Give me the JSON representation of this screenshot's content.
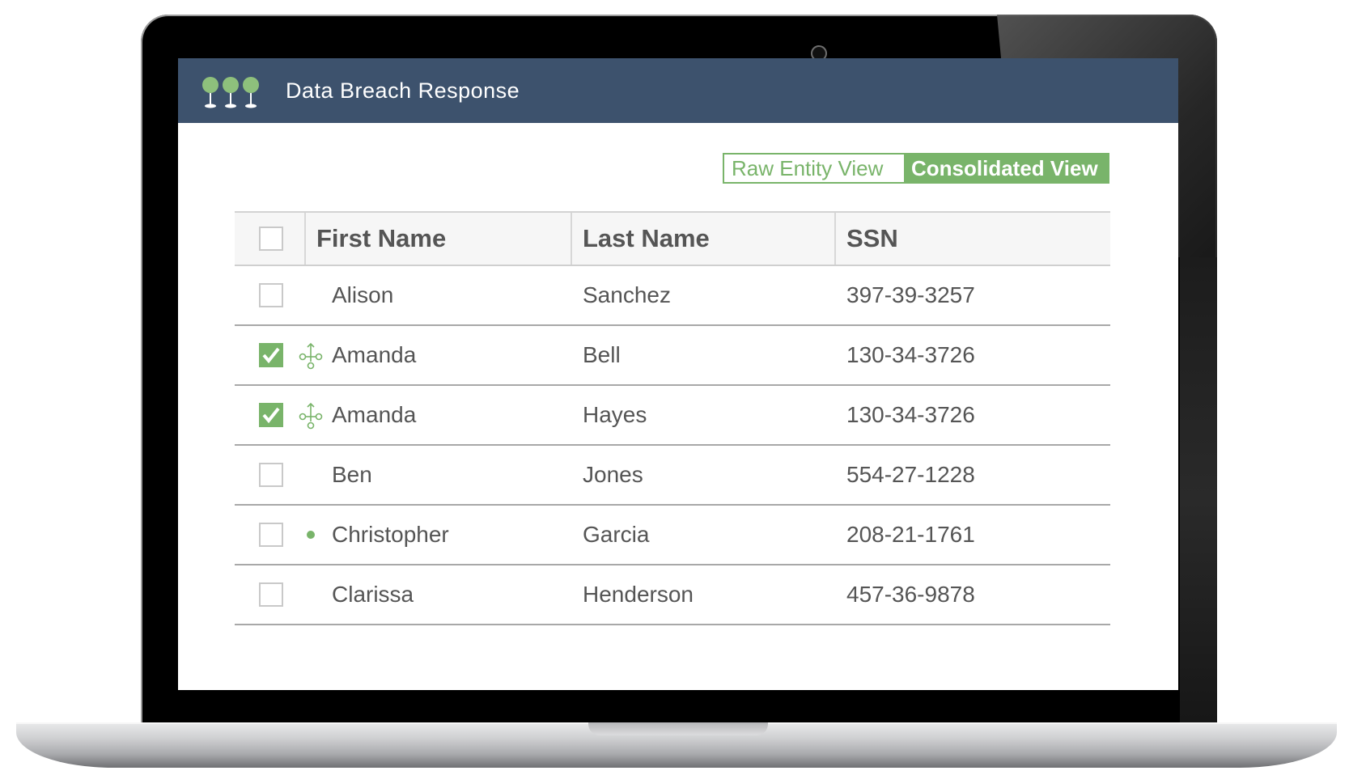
{
  "app": {
    "title": "Data Breach Response"
  },
  "view_toggle": {
    "raw_label": "Raw Entity View",
    "consolidated_label": "Consolidated View",
    "active": "Consolidated View"
  },
  "colors": {
    "header_bg": "#3d526d",
    "accent": "#79b46a"
  },
  "table": {
    "columns": [
      "First Name",
      "Last Name",
      "SSN"
    ],
    "rows": [
      {
        "checked": false,
        "marker": "none",
        "first": "Alison",
        "last": "Sanchez",
        "ssn": "397-39-3257"
      },
      {
        "checked": true,
        "marker": "link-icon",
        "first": "Amanda",
        "last": "Bell",
        "ssn": "130-34-3726"
      },
      {
        "checked": true,
        "marker": "link-icon",
        "first": "Amanda",
        "last": "Hayes",
        "ssn": "130-34-3726"
      },
      {
        "checked": false,
        "marker": "none",
        "first": "Ben",
        "last": "Jones",
        "ssn": "554-27-1228"
      },
      {
        "checked": false,
        "marker": "dot",
        "first": "Christopher",
        "last": "Garcia",
        "ssn": "208-21-1761"
      },
      {
        "checked": false,
        "marker": "none",
        "first": "Clarissa",
        "last": "Henderson",
        "ssn": "457-36-9878"
      }
    ]
  }
}
